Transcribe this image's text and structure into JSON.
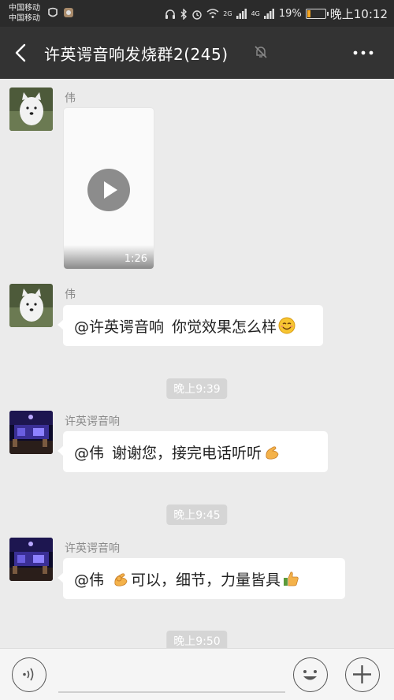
{
  "status_bar": {
    "carrier_1": "中国移动",
    "carrier_2": "中国移动",
    "network_1": "2G",
    "network_2": "4G",
    "battery_percent": "19%",
    "time": "晚上10:12"
  },
  "header": {
    "title": "许英谔音响发烧群2(245)"
  },
  "messages": [
    {
      "type": "video",
      "sender": "伟",
      "duration": "1:26"
    },
    {
      "type": "text",
      "sender": "伟",
      "mention": "@许英谔音响",
      "text": "你觉效果怎么样",
      "emoji": "smile-emoji"
    },
    {
      "type": "time",
      "text": "晚上9:39"
    },
    {
      "type": "text",
      "sender": "许英谔音响",
      "mention": "@伟",
      "text": "谢谢您，接完电话听听",
      "emoji": "ok-hand-emoji"
    },
    {
      "type": "time",
      "text": "晚上9:45"
    },
    {
      "type": "text",
      "sender": "许英谔音响",
      "mention": "@伟",
      "text_before_emoji": "",
      "text": "可以，细节，力量皆具",
      "emoji": "thumbs-up-emoji"
    },
    {
      "type": "time",
      "text": "晚上9:50"
    }
  ],
  "colors": {
    "header_bg": "#333333",
    "chat_bg": "#ebebeb",
    "bubble_bg": "#ffffff",
    "battery_low": "#f5a623"
  }
}
